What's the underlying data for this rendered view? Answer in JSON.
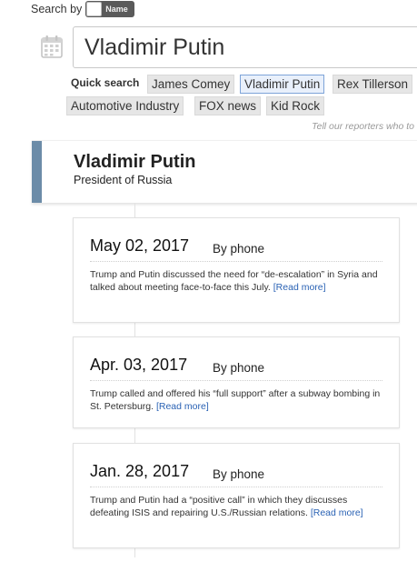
{
  "search_by": {
    "label": "Search by",
    "toggle_label": "Name"
  },
  "search": {
    "value": "Vladimir Putin"
  },
  "quick_search": {
    "label": "Quick search",
    "chips": [
      "James Comey",
      "Vladimir Putin",
      "Rex Tillerson",
      "Automotive Industry",
      "FOX news",
      "Kid Rock"
    ],
    "active": "Vladimir Putin"
  },
  "tell_reporters": "Tell our reporters who to",
  "person": {
    "name": "Vladimir Putin",
    "title": "President of Russia"
  },
  "calls": [
    {
      "date": "May 02, 2017",
      "method": "By phone",
      "text": "Trump and Putin discussed the need for “de-escalation” in Syria and talked about meeting face-to-face this July.",
      "read_more": "[Read more]"
    },
    {
      "date": "Apr. 03, 2017",
      "method": "By phone",
      "text": "Trump called and offered his “full support” after a subway bombing in St. Petersburg.",
      "read_more": "[Read more]"
    },
    {
      "date": "Jan. 28, 2017",
      "method": "By phone",
      "text": "Trump and Putin had a “positive call” in which they discusses defeating ISIS and repairing U.S./Russian relations.",
      "read_more": "[Read more]"
    }
  ],
  "colors": {
    "accent_bar": "#6c8ca8",
    "link": "#2a62b4",
    "chip_bg": "#e6e6e6",
    "chip_active_border": "#7ea4d8"
  },
  "icons": {
    "calendar": "calendar-icon"
  }
}
